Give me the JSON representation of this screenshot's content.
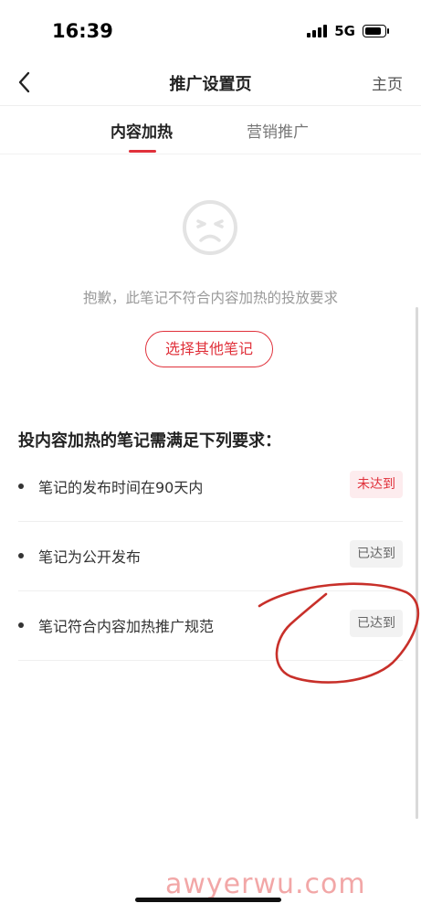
{
  "status_bar": {
    "time": "16:39",
    "network": "5G"
  },
  "nav": {
    "title": "推广设置页",
    "home_label": "主页"
  },
  "tabs": [
    {
      "label": "内容加热",
      "active": true
    },
    {
      "label": "营销推广",
      "active": false
    }
  ],
  "empty_state": {
    "message": "抱歉，此笔记不符合内容加热的投放要求",
    "button_label": "选择其他笔记"
  },
  "requirements": {
    "title": "投内容加热的笔记需满足下列要求：",
    "items": [
      {
        "text": "笔记的发布时间在90天内",
        "status": "未达到"
      },
      {
        "text": "笔记为公开发布",
        "status": "已达到"
      },
      {
        "text": "笔记符合内容加热推广规范",
        "status": "已达到"
      }
    ]
  },
  "watermark": "awyerwu.com",
  "colors": {
    "accent": "#e0313b",
    "annotation": "#c8302a"
  }
}
